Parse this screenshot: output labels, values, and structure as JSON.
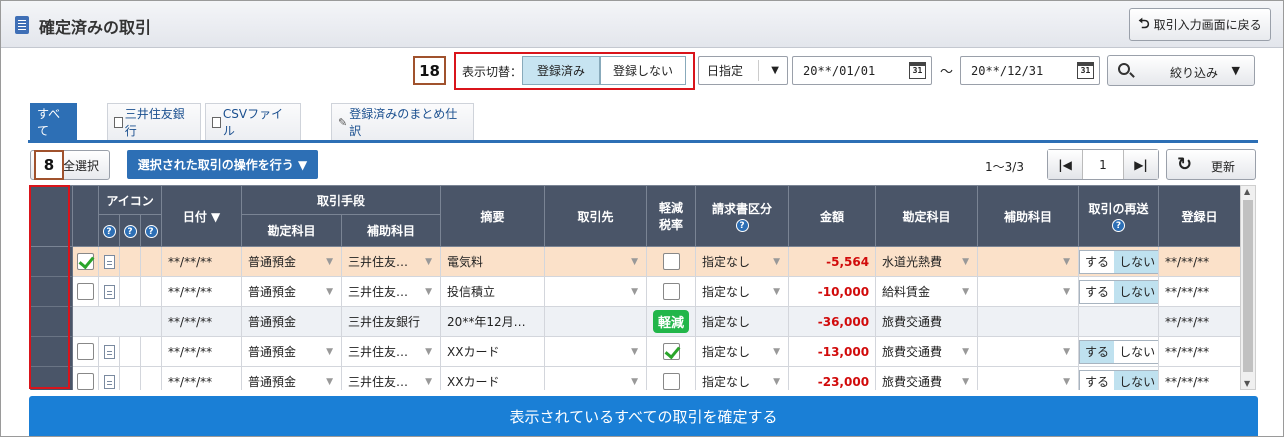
{
  "header": {
    "title": "確定済みの取引",
    "back_label": "取引入力画面に戻る",
    "back_icon": "return-arrow-icon"
  },
  "filter": {
    "toggle_label": "表示切替：",
    "toggle_on": "登録済み",
    "toggle_off": "登録しない",
    "date_mode": "日指定",
    "date_from": "20**/01/01",
    "date_to": "20**/12/31",
    "calendar_text": "31",
    "tilde": "～",
    "narrow_label": "絞り込み"
  },
  "badges": {
    "filter_badge": "18",
    "column_badge": "8"
  },
  "tabs": [
    "すべて",
    "三井住友銀行",
    "CSVファイル",
    "登録済みのまとめ仕訳"
  ],
  "toolbar": {
    "select_all": "全選択",
    "operation": "選択された取引の操作を行う ▼",
    "range": "1～3/3",
    "page": "1",
    "refresh": "更新"
  },
  "table": {
    "headers": {
      "icon": "アイコン",
      "date": "日付 ▼",
      "method": "取引手段",
      "method_account": "勘定科目",
      "method_sub": "補助科目",
      "summary": "摘要",
      "partner": "取引先",
      "reduced_line1": "軽減",
      "reduced_line2": "税率",
      "invoice": "請求書区分",
      "amount": "金額",
      "account": "勘定科目",
      "sub_account": "補助科目",
      "resend": "取引の再送",
      "reg_date": "登録日"
    },
    "rows": [
      {
        "date": "**/**/**",
        "m_account": "普通預金",
        "m_sub": "三井住友…",
        "summary": "電気料",
        "invoice": "指定なし",
        "amount": "-5,564",
        "account": "水道光熱費",
        "resend_yes": "する",
        "resend_no": "しない",
        "reg": "**/**/**"
      },
      {
        "date": "**/**/**",
        "m_account": "普通預金",
        "m_sub": "三井住友…",
        "summary": "投信積立",
        "invoice": "指定なし",
        "amount": "-10,000",
        "account": "給料賃金",
        "resend_yes": "する",
        "resend_no": "しない",
        "reg": "**/**/**"
      },
      {
        "date": "**/**/**",
        "m_account": "普通預金",
        "m_sub": "三井住友銀行",
        "summary": "20**年12月…",
        "reduced_badge": "軽減",
        "invoice": "指定なし",
        "amount": "-36,000",
        "account": "旅費交通費",
        "reg": "**/**/**"
      },
      {
        "date": "**/**/**",
        "m_account": "普通預金",
        "m_sub": "三井住友…",
        "summary": "XXカード",
        "invoice": "指定なし",
        "amount": "-13,000",
        "account": "旅費交通費",
        "resend_yes": "する",
        "resend_no": "しない",
        "reg": "**/**/**"
      },
      {
        "date": "**/**/**",
        "m_account": "普通預金",
        "m_sub": "三井住友…",
        "summary": "XXカード",
        "invoice": "指定なし",
        "amount": "-23,000",
        "account": "旅費交通費",
        "resend_yes": "する",
        "resend_no": "しない",
        "reg": "**/**/**"
      }
    ]
  },
  "confirm_label": "表示されているすべての取引を確定する",
  "colors": {
    "accent": "#2d6fb5",
    "confirm": "#1a7fd6",
    "highlight_row": "#fbe1c9",
    "negative": "#d10b0b",
    "red_frame": "#d9141b"
  }
}
